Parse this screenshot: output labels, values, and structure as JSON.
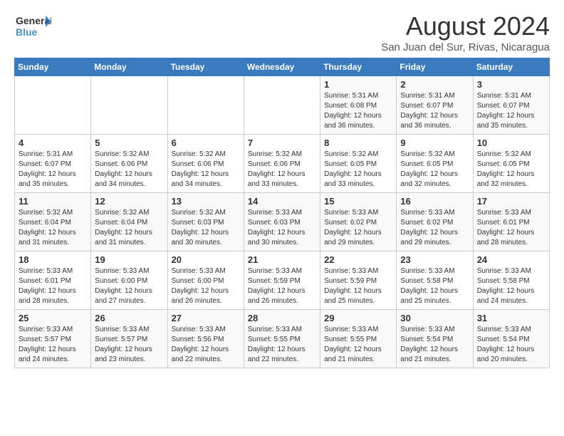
{
  "logo": {
    "line1": "General",
    "line2": "Blue"
  },
  "calendar": {
    "title": "August 2024",
    "subtitle": "San Juan del Sur, Rivas, Nicaragua"
  },
  "weekdays": [
    "Sunday",
    "Monday",
    "Tuesday",
    "Wednesday",
    "Thursday",
    "Friday",
    "Saturday"
  ],
  "weeks": [
    [
      {
        "day": "",
        "info": ""
      },
      {
        "day": "",
        "info": ""
      },
      {
        "day": "",
        "info": ""
      },
      {
        "day": "",
        "info": ""
      },
      {
        "day": "1",
        "info": "Sunrise: 5:31 AM\nSunset: 6:08 PM\nDaylight: 12 hours\nand 36 minutes."
      },
      {
        "day": "2",
        "info": "Sunrise: 5:31 AM\nSunset: 6:07 PM\nDaylight: 12 hours\nand 36 minutes."
      },
      {
        "day": "3",
        "info": "Sunrise: 5:31 AM\nSunset: 6:07 PM\nDaylight: 12 hours\nand 35 minutes."
      }
    ],
    [
      {
        "day": "4",
        "info": "Sunrise: 5:31 AM\nSunset: 6:07 PM\nDaylight: 12 hours\nand 35 minutes."
      },
      {
        "day": "5",
        "info": "Sunrise: 5:32 AM\nSunset: 6:06 PM\nDaylight: 12 hours\nand 34 minutes."
      },
      {
        "day": "6",
        "info": "Sunrise: 5:32 AM\nSunset: 6:06 PM\nDaylight: 12 hours\nand 34 minutes."
      },
      {
        "day": "7",
        "info": "Sunrise: 5:32 AM\nSunset: 6:06 PM\nDaylight: 12 hours\nand 33 minutes."
      },
      {
        "day": "8",
        "info": "Sunrise: 5:32 AM\nSunset: 6:05 PM\nDaylight: 12 hours\nand 33 minutes."
      },
      {
        "day": "9",
        "info": "Sunrise: 5:32 AM\nSunset: 6:05 PM\nDaylight: 12 hours\nand 32 minutes."
      },
      {
        "day": "10",
        "info": "Sunrise: 5:32 AM\nSunset: 6:05 PM\nDaylight: 12 hours\nand 32 minutes."
      }
    ],
    [
      {
        "day": "11",
        "info": "Sunrise: 5:32 AM\nSunset: 6:04 PM\nDaylight: 12 hours\nand 31 minutes."
      },
      {
        "day": "12",
        "info": "Sunrise: 5:32 AM\nSunset: 6:04 PM\nDaylight: 12 hours\nand 31 minutes."
      },
      {
        "day": "13",
        "info": "Sunrise: 5:32 AM\nSunset: 6:03 PM\nDaylight: 12 hours\nand 30 minutes."
      },
      {
        "day": "14",
        "info": "Sunrise: 5:33 AM\nSunset: 6:03 PM\nDaylight: 12 hours\nand 30 minutes."
      },
      {
        "day": "15",
        "info": "Sunrise: 5:33 AM\nSunset: 6:02 PM\nDaylight: 12 hours\nand 29 minutes."
      },
      {
        "day": "16",
        "info": "Sunrise: 5:33 AM\nSunset: 6:02 PM\nDaylight: 12 hours\nand 29 minutes."
      },
      {
        "day": "17",
        "info": "Sunrise: 5:33 AM\nSunset: 6:01 PM\nDaylight: 12 hours\nand 28 minutes."
      }
    ],
    [
      {
        "day": "18",
        "info": "Sunrise: 5:33 AM\nSunset: 6:01 PM\nDaylight: 12 hours\nand 28 minutes."
      },
      {
        "day": "19",
        "info": "Sunrise: 5:33 AM\nSunset: 6:00 PM\nDaylight: 12 hours\nand 27 minutes."
      },
      {
        "day": "20",
        "info": "Sunrise: 5:33 AM\nSunset: 6:00 PM\nDaylight: 12 hours\nand 26 minutes."
      },
      {
        "day": "21",
        "info": "Sunrise: 5:33 AM\nSunset: 5:59 PM\nDaylight: 12 hours\nand 26 minutes."
      },
      {
        "day": "22",
        "info": "Sunrise: 5:33 AM\nSunset: 5:59 PM\nDaylight: 12 hours\nand 25 minutes."
      },
      {
        "day": "23",
        "info": "Sunrise: 5:33 AM\nSunset: 5:58 PM\nDaylight: 12 hours\nand 25 minutes."
      },
      {
        "day": "24",
        "info": "Sunrise: 5:33 AM\nSunset: 5:58 PM\nDaylight: 12 hours\nand 24 minutes."
      }
    ],
    [
      {
        "day": "25",
        "info": "Sunrise: 5:33 AM\nSunset: 5:57 PM\nDaylight: 12 hours\nand 24 minutes."
      },
      {
        "day": "26",
        "info": "Sunrise: 5:33 AM\nSunset: 5:57 PM\nDaylight: 12 hours\nand 23 minutes."
      },
      {
        "day": "27",
        "info": "Sunrise: 5:33 AM\nSunset: 5:56 PM\nDaylight: 12 hours\nand 22 minutes."
      },
      {
        "day": "28",
        "info": "Sunrise: 5:33 AM\nSunset: 5:55 PM\nDaylight: 12 hours\nand 22 minutes."
      },
      {
        "day": "29",
        "info": "Sunrise: 5:33 AM\nSunset: 5:55 PM\nDaylight: 12 hours\nand 21 minutes."
      },
      {
        "day": "30",
        "info": "Sunrise: 5:33 AM\nSunset: 5:54 PM\nDaylight: 12 hours\nand 21 minutes."
      },
      {
        "day": "31",
        "info": "Sunrise: 5:33 AM\nSunset: 5:54 PM\nDaylight: 12 hours\nand 20 minutes."
      }
    ]
  ]
}
